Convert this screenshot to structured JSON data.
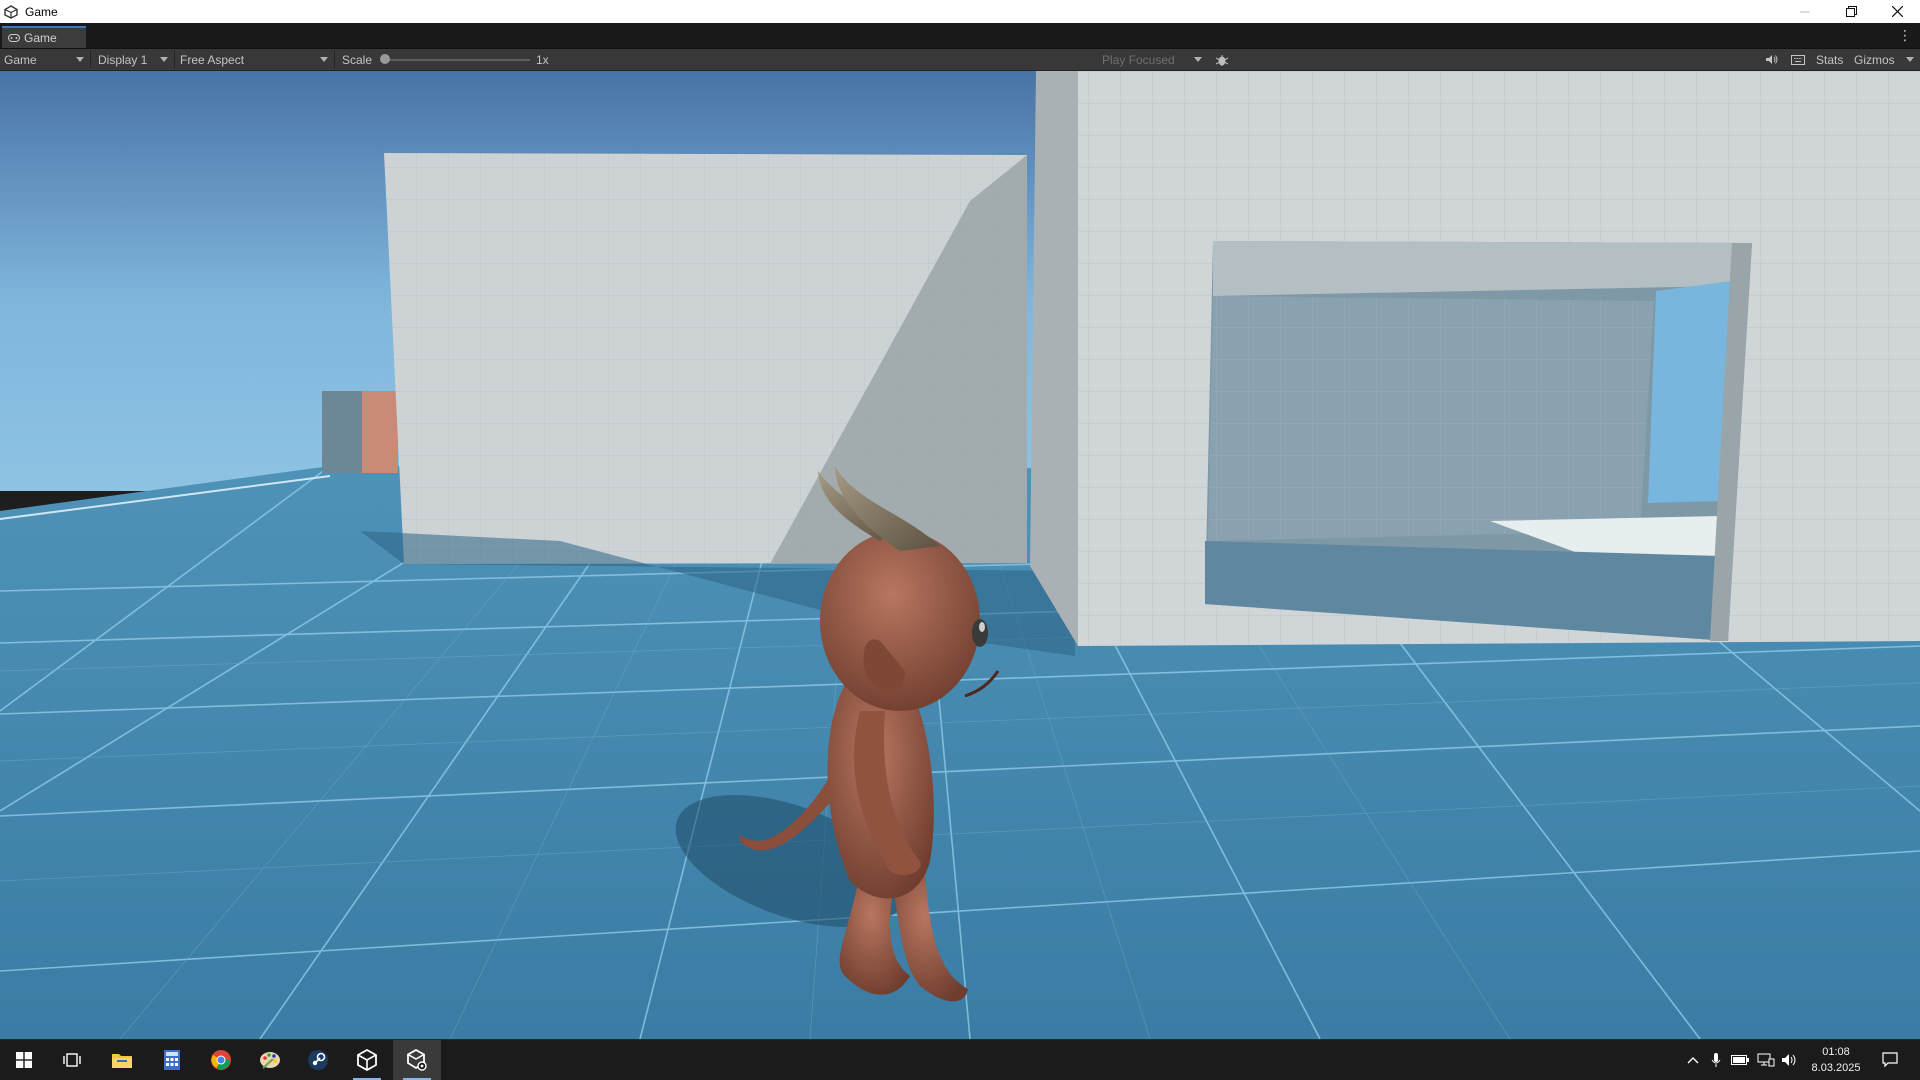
{
  "window": {
    "title": "Game"
  },
  "tab": {
    "label": "Game"
  },
  "toolbar": {
    "mode": "Game",
    "display": "Display 1",
    "aspect": "Free Aspect",
    "scale_label": "Scale",
    "scale_value": "1x",
    "play_mode": "Play Focused",
    "stats": "Stats",
    "gizmos": "Gizmos"
  },
  "taskbar": {
    "time": "01:08",
    "date": "8.03.2025",
    "apps": [
      "windows-start",
      "task-view",
      "file-explorer",
      "calculator",
      "chrome",
      "paint",
      "steam",
      "unity-hub",
      "unity-editor"
    ]
  },
  "colors": {
    "sky_top": "#4a78a8",
    "sky_horizon": "#8fc1e2",
    "ground": "#3f7fa4",
    "wall": "#c9cfd1",
    "creature": "#9a5d48",
    "horns": "#7d725e"
  }
}
